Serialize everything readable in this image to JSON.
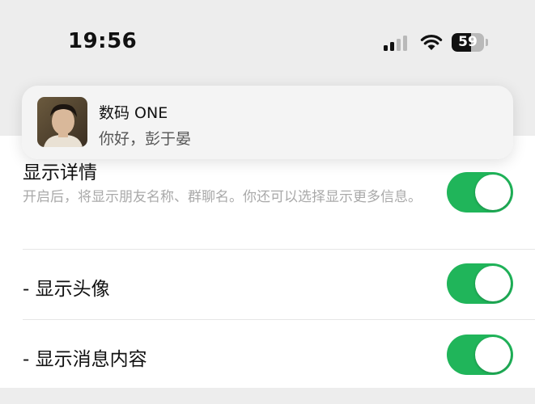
{
  "status_bar": {
    "time": "19:56",
    "battery_percent": "59",
    "battery_level": 0.59,
    "signal_bars_active": 2,
    "signal_bars_total": 4
  },
  "notification": {
    "title": "数码 ONE",
    "message": "你好，彭于晏"
  },
  "settings": {
    "show_details": {
      "title": "显示详情",
      "description": "开启后，将显示朋友名称、群聊名。你还可以选择显示更多信息。",
      "enabled": true
    },
    "show_avatar": {
      "label": "- 显示头像",
      "enabled": true
    },
    "show_message_content": {
      "label": "- 显示消息内容",
      "enabled": true
    }
  },
  "colors": {
    "toggle_on": "#20b55a",
    "page_background": "#ededed"
  }
}
